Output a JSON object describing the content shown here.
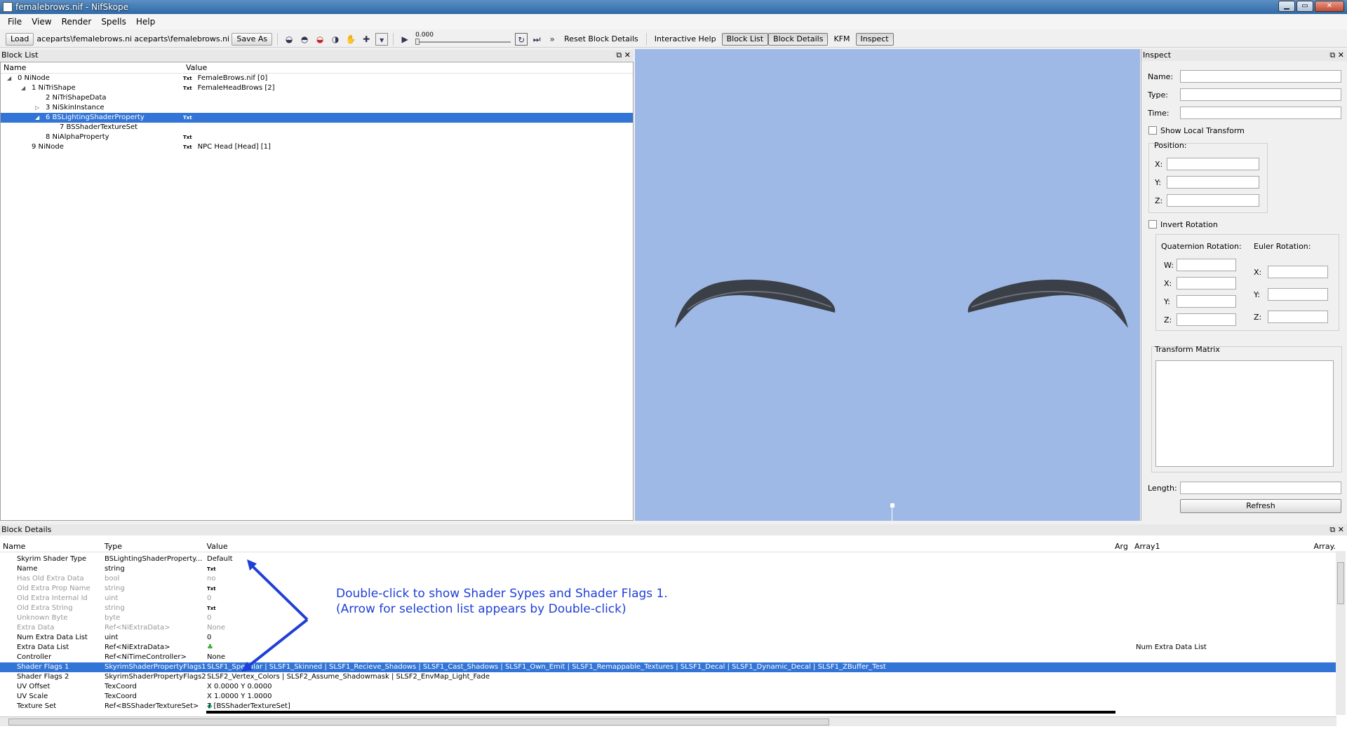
{
  "window": {
    "title": "femalebrows.nif - NifSkope"
  },
  "menu": [
    "File",
    "View",
    "Render",
    "Spells",
    "Help"
  ],
  "toolbar": {
    "load": "Load",
    "load_path": "aceparts\\femalebrows.nif",
    "save_path": "aceparts\\femalebrows.nif",
    "save_as": "Save As",
    "time_value": "0.000",
    "reset_block_details": "Reset Block Details",
    "interactive_help": "Interactive Help",
    "block_list": "Block List",
    "block_details": "Block Details",
    "kfm": "KFM",
    "inspect": "Inspect"
  },
  "block_list": {
    "title": "Block List",
    "col_name": "Name",
    "col_value": "Value",
    "txt": "Txt",
    "rows": [
      {
        "name": "0 NiNode",
        "value": "FemaleBrows.nif [0]"
      },
      {
        "name": "1 NiTriShape",
        "value": "FemaleHeadBrows [2]"
      },
      {
        "name": "2 NiTriShapeData",
        "value": ""
      },
      {
        "name": "3 NiSkinInstance",
        "value": ""
      },
      {
        "name": "6 BSLightingShaderProperty",
        "value": ""
      },
      {
        "name": "7 BSShaderTextureSet",
        "value": ""
      },
      {
        "name": "8 NiAlphaProperty",
        "value": ""
      },
      {
        "name": "9 NiNode",
        "value": "NPC Head [Head] [1]"
      }
    ]
  },
  "inspect": {
    "title": "Inspect",
    "name": "Name:",
    "type": "Type:",
    "time": "Time:",
    "show_local_transform": "Show Local Transform",
    "position": "Position:",
    "x": "X:",
    "y": "Y:",
    "z": "Z:",
    "w": "W:",
    "invert_rotation": "Invert Rotation",
    "quaternion_rotation": "Quaternion Rotation:",
    "euler_rotation": "Euler Rotation:",
    "transform_matrix": "Transform Matrix",
    "length": "Length:",
    "refresh": "Refresh"
  },
  "block_details": {
    "title": "Block Details",
    "col_name": "Name",
    "col_type": "Type",
    "col_value": "Value",
    "col_arg": "Arg",
    "col_array1": "Array1",
    "col_array": "Array.",
    "txt": "Txt",
    "num_extra_data_list": "Num Extra Data List",
    "rows": [
      {
        "name": "Skyrim Shader Type",
        "type": "BSLightingShaderProperty...",
        "value": "Default"
      },
      {
        "name": "Name",
        "type": "string",
        "value": "Txt"
      },
      {
        "name": "Has Old Extra Data",
        "type": "bool",
        "value": "no"
      },
      {
        "name": "Old Extra Prop Name",
        "type": "string",
        "value": "Txt"
      },
      {
        "name": "Old Extra Internal Id",
        "type": "uint",
        "value": "0"
      },
      {
        "name": "Old Extra String",
        "type": "string",
        "value": "Txt"
      },
      {
        "name": "Unknown Byte",
        "type": "byte",
        "value": "0"
      },
      {
        "name": "Extra Data",
        "type": "Ref<NiExtraData>",
        "value": "None"
      },
      {
        "name": "Num Extra Data List",
        "type": "uint",
        "value": "0"
      },
      {
        "name": "Extra Data List",
        "type": "Ref<NiExtraData>",
        "value": ""
      },
      {
        "name": "Controller",
        "type": "Ref<NiTimeController>",
        "value": "None"
      },
      {
        "name": "Shader Flags 1",
        "type": "SkyrimShaderPropertyFlags1",
        "value": "SLSF1_Specular | SLSF1_Skinned | SLSF1_Recieve_Shadows | SLSF1_Cast_Shadows | SLSF1_Own_Emit | SLSF1_Remappable_Textures | SLSF1_Decal | SLSF1_Dynamic_Decal | SLSF1_ZBuffer_Test"
      },
      {
        "name": "Shader Flags 2",
        "type": "SkyrimShaderPropertyFlags2",
        "value": "SLSF2_Vertex_Colors | SLSF2_Assume_Shadowmask | SLSF2_EnvMap_Light_Fade"
      },
      {
        "name": "UV Offset",
        "type": "TexCoord",
        "value": "X 0.0000 Y 0.0000"
      },
      {
        "name": "UV Scale",
        "type": "TexCoord",
        "value": "X 1.0000 Y 1.0000"
      },
      {
        "name": "Texture Set",
        "type": "Ref<BSShaderTextureSet>",
        "value": "7 [BSShaderTextureSet]"
      }
    ]
  },
  "annotation": {
    "line1": "Double-click to show Shader Sypes and Shader Flags 1.",
    "line2": "(Arrow for selection list appears by Double-click)"
  },
  "colors": {
    "selection": "#3375d6",
    "viewport": "#9fb9e6",
    "annotation": "#1f3fd6"
  }
}
